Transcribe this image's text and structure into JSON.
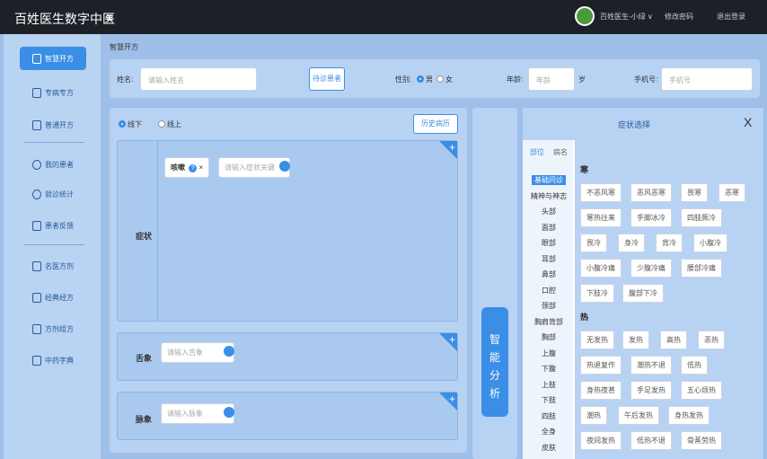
{
  "header": {
    "title": "百姓医生数字中医",
    "menu_icon": "≡",
    "user": "百姓医生-小绿 ∨",
    "change_password": "修改密码",
    "logout": "退出登录"
  },
  "sidebar": {
    "items": [
      {
        "label": "智慧开方",
        "icon": "doc-icon"
      },
      {
        "label": "专病专方",
        "icon": "list-icon"
      },
      {
        "label": "普通开方",
        "icon": "list-icon"
      },
      {
        "label": "我的患者",
        "icon": "user-icon"
      },
      {
        "label": "就诊统计",
        "icon": "clock-icon"
      },
      {
        "label": "患者反馈",
        "icon": "mail-icon"
      },
      {
        "label": "名医方剂",
        "icon": "book-icon"
      },
      {
        "label": "经典经方",
        "icon": "book-icon"
      },
      {
        "label": "方剂组方",
        "icon": "book-icon"
      },
      {
        "label": "中药字典",
        "icon": "book-icon"
      }
    ]
  },
  "breadcrumb": "智慧开方",
  "patient": {
    "name_label": "姓名:",
    "name_placeholder": "请输入姓名",
    "history_button": "待诊患者",
    "gender_label": "性别:",
    "gender_male": "男",
    "gender_female": "女",
    "age_label": "年龄:",
    "age_placeholder": "年龄",
    "age_unit": "岁",
    "phone_label": "手机号:",
    "phone_placeholder": "手机号"
  },
  "mode": {
    "offline": "线下",
    "online": "线上",
    "history_records": "历史病历"
  },
  "symptoms": {
    "label": "症状",
    "tag": "咳嗽",
    "input_placeholder": "请输入症状关键",
    "tongue_label": "舌象",
    "tongue_placeholder": "请输入舌象",
    "pulse_label": "脉象",
    "pulse_placeholder": "请输入脉象"
  },
  "analysis_button": [
    "智",
    "能",
    "分",
    "析"
  ],
  "selector": {
    "title": "症状选择",
    "close": "X",
    "tab_part": "部位",
    "tab_other": "病名",
    "parts": [
      "基础问诊",
      "精神与神志",
      "头部",
      "面部",
      "眼部",
      "耳部",
      "鼻部",
      "口腔",
      "颈部",
      "胸肩背部",
      "胸部",
      "上腹",
      "下腹",
      "上肢",
      "下肢",
      "四肢",
      "全身",
      "皮肤"
    ],
    "section_cold": "寒",
    "cold_items": [
      "不恶风寒",
      "恶风恶寒",
      "畏寒",
      "恶寒",
      "寒热往来",
      "手脚冰冷",
      "四肢厥冷",
      "畏冷",
      "身冷",
      "背冷",
      "小腹冷",
      "小腹冷痛",
      "少腹冷痛",
      "腰部冷痛",
      "下肢冷",
      "腹部下冷"
    ],
    "section_heat": "热",
    "heat_items": [
      "无发热",
      "发热",
      "高热",
      "恶热",
      "热退复作",
      "潮热不退",
      "低热",
      "身热夜甚",
      "手足发热",
      "五心烦热",
      "潮热",
      "午后发热",
      "身热发热",
      "夜间发热",
      "低热不退",
      "骨蒸劳热"
    ]
  }
}
